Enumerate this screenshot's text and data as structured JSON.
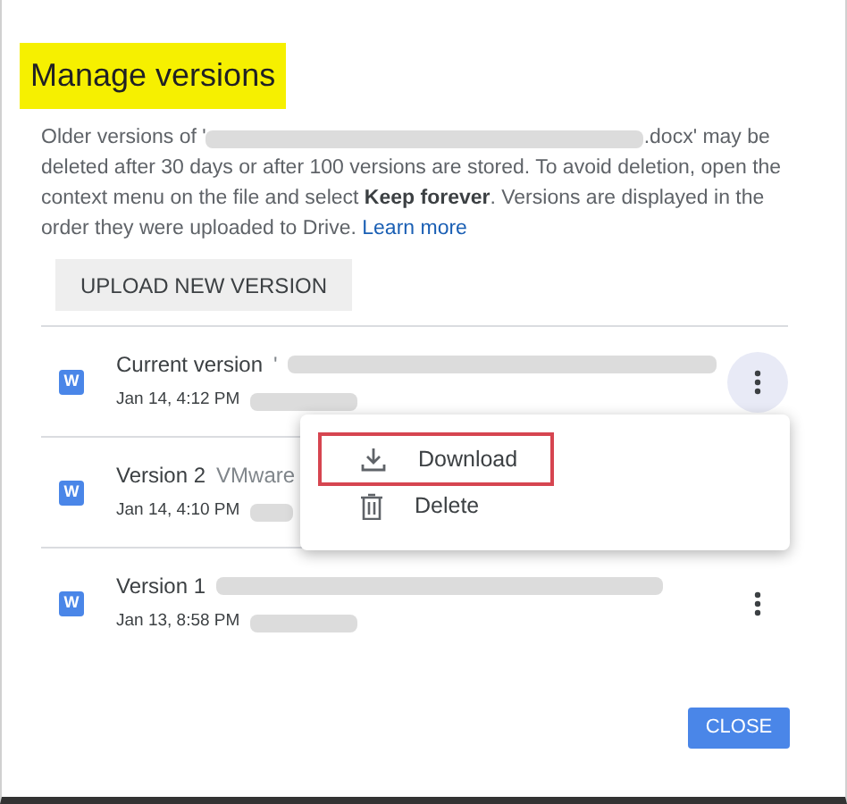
{
  "dialog": {
    "title": "Manage versions",
    "title_highlighted": true,
    "description_before": "Older versions of '",
    "description_after": ".docx' may be",
    "description_rest": "deleted after 30 days or after 100 versions are stored. To avoid deletion, open the context menu on the file and select **Keep forever**. Versions are displayed in the order they were uploaded to Drive.",
    "learn_more": "Learn more",
    "upload_button": "UPLOAD NEW VERSION",
    "versions": [
      {
        "badge": "W",
        "label": "Current version",
        "name": "'",
        "date": "Jan 14, 4:12 PM",
        "menu_open": true
      },
      {
        "badge": "W",
        "label": "Version 2",
        "name": "VMware",
        "date": "Jan 14, 4:10 PM"
      },
      {
        "badge": "W",
        "label": "Version 1",
        "date": "Jan 13, 8:58 PM",
        "menu_open": false
      }
    ],
    "menu": [
      {
        "kind": "download",
        "label": "Download",
        "highlighted": true
      },
      {
        "kind": "delete",
        "label": "Delete",
        "highlighted": false
      }
    ],
    "close_button": "CLOSE"
  }
}
